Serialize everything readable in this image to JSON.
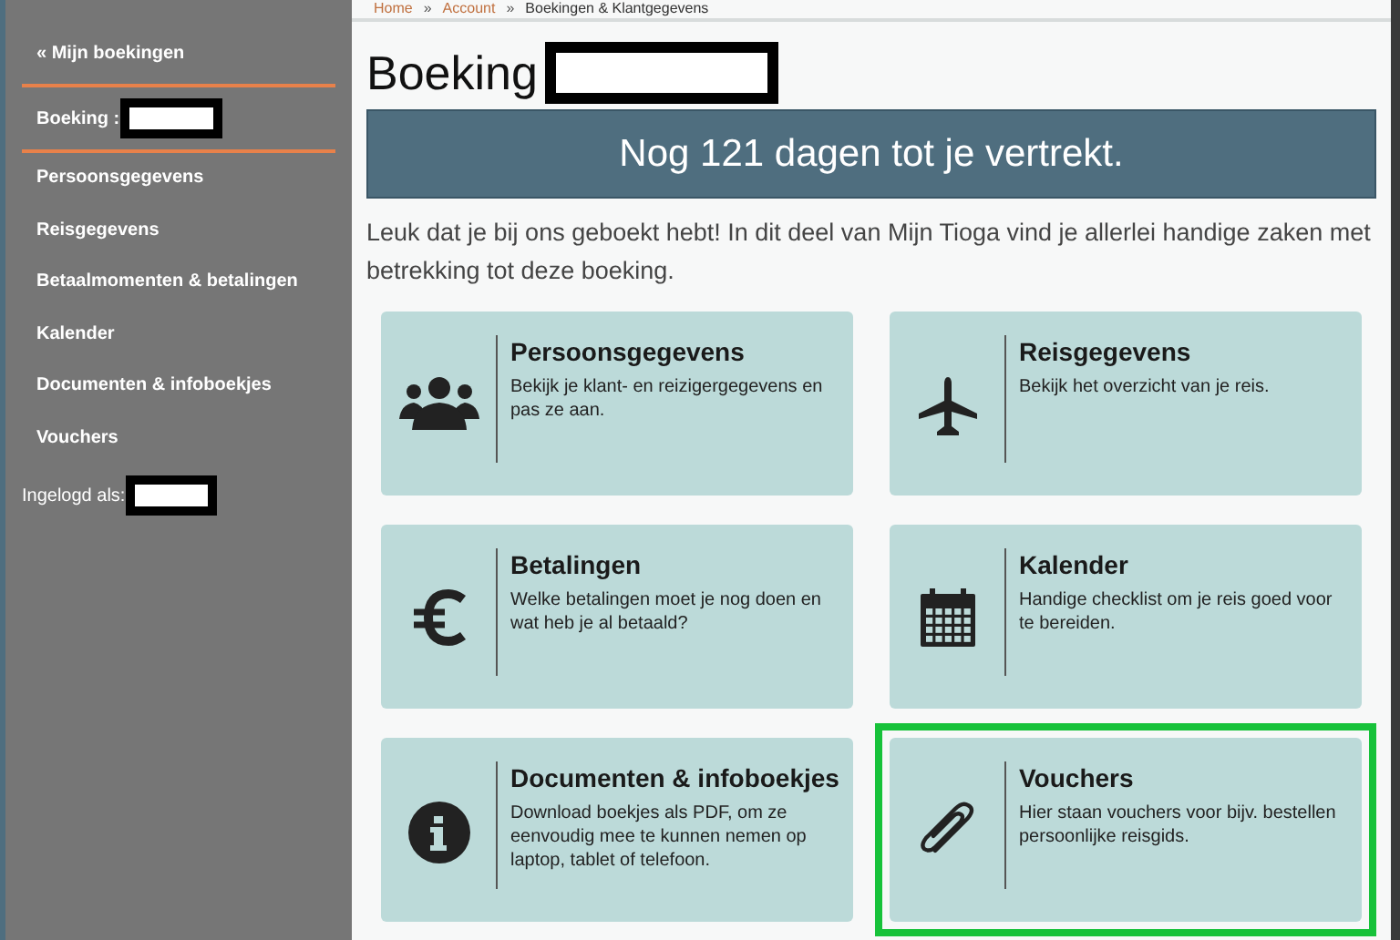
{
  "sidebar": {
    "back_link": "« Mijn boekingen",
    "booking_label": "Boeking :",
    "items": [
      {
        "label": "Persoonsgegevens"
      },
      {
        "label": "Reisgegevens"
      },
      {
        "label": "Betaalmomenten & betalingen"
      },
      {
        "label": "Kalender"
      },
      {
        "label": "Documenten & infoboekjes"
      },
      {
        "label": "Vouchers"
      }
    ],
    "logged_in_label": "Ingelogd als:"
  },
  "breadcrumb": [
    {
      "label": "Home",
      "kind": "link"
    },
    {
      "label": "Account",
      "kind": "link"
    },
    {
      "label": "Boekingen & Klantgegevens",
      "kind": "current"
    }
  ],
  "breadcrumb_separator": "»",
  "heading": "Boeking",
  "countdown": "Nog 121 dagen tot je vertrekt.",
  "intro": "Leuk dat je bij ons geboekt hebt! In dit deel van Mijn Tioga vind je allerlei handige zaken met betrekking tot deze boeking.",
  "cards": [
    {
      "kind": "people",
      "title": "Persoonsgegevens",
      "text": "Bekijk je klant- en reizigergegevens en pas ze aan.",
      "highlighted": false
    },
    {
      "kind": "plane",
      "title": "Reisgegevens",
      "text": "Bekijk het overzicht van je reis.",
      "highlighted": false
    },
    {
      "kind": "euro",
      "title": "Betalingen",
      "text": "Welke betalingen moet je nog doen en wat heb je al betaald?",
      "highlighted": false
    },
    {
      "kind": "calendar",
      "title": "Kalender",
      "text": "Handige checklist om je reis goed voor te bereiden.",
      "highlighted": false
    },
    {
      "kind": "info",
      "title": "Documenten & infoboekjes",
      "text": "Download boekjes als PDF, om ze eenvoudig mee te kunnen nemen op laptop, tablet of telefoon.",
      "highlighted": false
    },
    {
      "kind": "paperclip",
      "title": "Vouchers",
      "text": "Hier staan vouchers voor bijv. bestellen persoonlijke reisgids.",
      "highlighted": true
    }
  ]
}
